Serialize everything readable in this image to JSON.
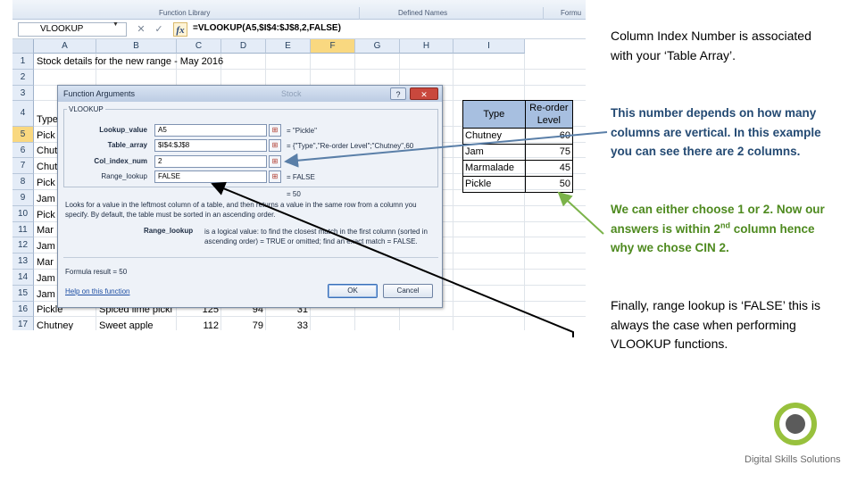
{
  "ribbon": {
    "groups": [
      "Function Library",
      "Defined Names",
      "Formu"
    ]
  },
  "formula_bar": {
    "name_box": "VLOOKUP",
    "cancel_glyph": "✕",
    "enter_glyph": "✓",
    "fx_glyph": "fx",
    "formula": "=VLOOKUP(A5,$I$4:$J$8,2,FALSE)"
  },
  "sheet": {
    "columns": [
      "A",
      "B",
      "C",
      "D",
      "E",
      "F",
      "G",
      "H",
      "I"
    ],
    "active_column": "F",
    "rows": [
      "1",
      "2",
      "3",
      "4",
      "5",
      "6",
      "7",
      "8",
      "9",
      "10",
      "11",
      "12",
      "13",
      "14",
      "15",
      "16",
      "17"
    ],
    "active_row": "5",
    "title": "Stock details for the new range - May 2016",
    "col_a_values": {
      "4": "Type",
      "5": "Pick",
      "6": "Chut",
      "7": "Chut",
      "8": "Pick",
      "9": "Jam",
      "10": "Pick",
      "11": "Mar",
      "12": "Jam",
      "13": "Mar",
      "14": "Jam",
      "15": "Jam",
      "16": "Pickle",
      "17": "Chutney"
    },
    "row16": {
      "b": "Spiced lime pickl",
      "c": "125",
      "d": "94",
      "e": "31"
    },
    "row17": {
      "b": "Sweet apple",
      "c": "112",
      "d": "79",
      "e": "33"
    }
  },
  "lookup_table": {
    "header_type": "Type",
    "header_level": "Re-order Level",
    "rows": [
      {
        "type": "Chutney",
        "level": "60"
      },
      {
        "type": "Jam",
        "level": "75"
      },
      {
        "type": "Marmalade",
        "level": "45"
      },
      {
        "type": "Pickle",
        "level": "50"
      }
    ]
  },
  "dialog": {
    "title": "Function Arguments",
    "ghost_title": "Stock",
    "help_ctrl": "?",
    "close_ctrl": "✕",
    "group_label": "VLOOKUP",
    "args": [
      {
        "label": "Lookup_value",
        "value": "A5",
        "result": "= \"Pickle\""
      },
      {
        "label": "Table_array",
        "value": "$I$4:$J$8",
        "result": "= {\"Type\",\"Re-order Level\";\"Chutney\",60"
      },
      {
        "label": "Col_index_num",
        "value": "2",
        "result": "= 2"
      },
      {
        "label": "Range_lookup",
        "value": "FALSE",
        "result": "= FALSE"
      }
    ],
    "ref_btn": "⊞",
    "fn_result": "= 50",
    "description": "Looks for a value in the leftmost column of a table, and then returns a value in the same row from a column you specify. By default, the table must be sorted in an ascending order.",
    "arg_help_label": "Range_lookup",
    "arg_help_text": "is a logical value: to find the closest match in the first column (sorted in ascending order) = TRUE or omitted; find an exact match = FALSE.",
    "formula_result": "Formula result =   50",
    "help_link": "Help on this function",
    "ok": "OK",
    "cancel": "Cancel"
  },
  "explanations": {
    "p1": "Column Index Number is associated with your ‘Table Array’.",
    "p2": "This number depends on how many columns are vertical. In this example you can see there are 2 columns.",
    "p3_a": "We can either choose 1 or 2. Now our answers is within 2",
    "p3_sup": "nd",
    "p3_b": " column hence why we chose CIN 2.",
    "p4": "Finally, range lookup is ‘FALSE’ this  is always the case when performing VLOOKUP functions."
  },
  "logo": {
    "text": "Digital Skills Solutions",
    "ring_color": "#98c13d",
    "dot_color": "#5b5b5b"
  },
  "colors": {
    "arrow_blue": "#5a7fa8",
    "arrow_green": "#7bb34a",
    "arrow_black": "#000000"
  }
}
